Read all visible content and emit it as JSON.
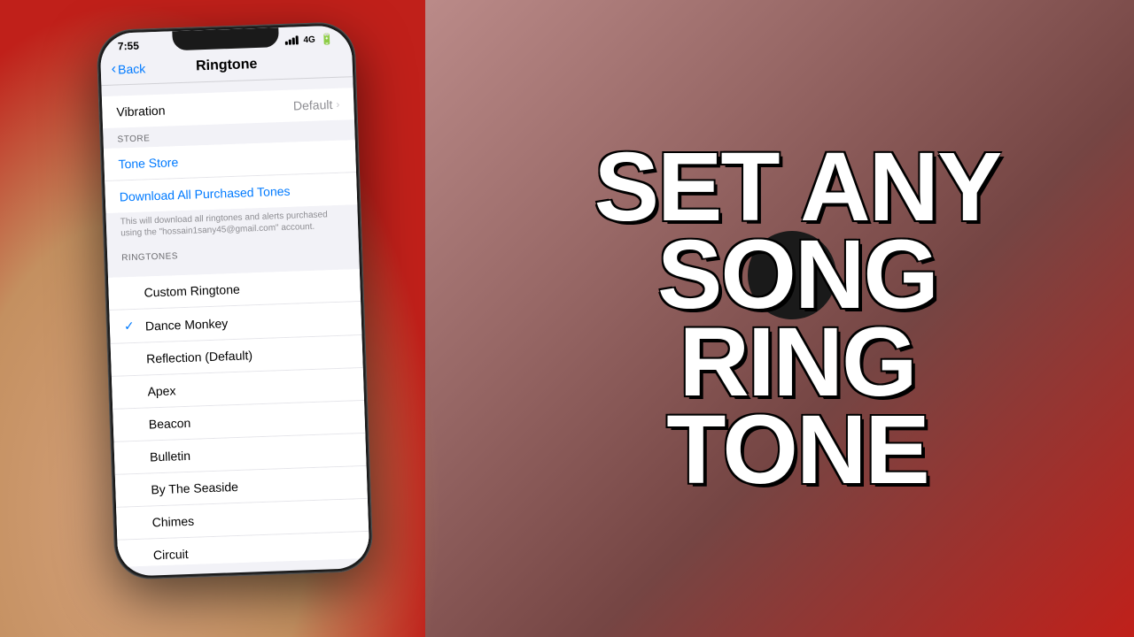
{
  "background": {
    "color": "#c0201a"
  },
  "overlay": {
    "line1": "SET ANY",
    "line2": "SONG",
    "line3": "RING",
    "line4": "TONE"
  },
  "phone": {
    "status_bar": {
      "time": "7:55",
      "signal": "4G",
      "battery": "■"
    },
    "nav": {
      "back_label": "Back",
      "title": "Ringtone"
    },
    "vibration": {
      "label": "Vibration",
      "value": "Default"
    },
    "store_section": {
      "header": "STORE",
      "tone_store": "Tone Store",
      "download_label": "Download All Purchased Tones",
      "note": "This will download all ringtones and alerts purchased using the \"hossain1sany45@gmail.com\" account."
    },
    "ringtones_section": {
      "header": "RINGTONES",
      "items": [
        {
          "name": "Custom Ringtone",
          "selected": false
        },
        {
          "name": "Dance Monkey",
          "selected": true
        },
        {
          "name": "Reflection (Default)",
          "selected": false
        },
        {
          "name": "Apex",
          "selected": false
        },
        {
          "name": "Beacon",
          "selected": false
        },
        {
          "name": "Bulletin",
          "selected": false
        },
        {
          "name": "By The Seaside",
          "selected": false
        },
        {
          "name": "Chimes",
          "selected": false
        },
        {
          "name": "Circuit",
          "selected": false
        }
      ]
    }
  }
}
